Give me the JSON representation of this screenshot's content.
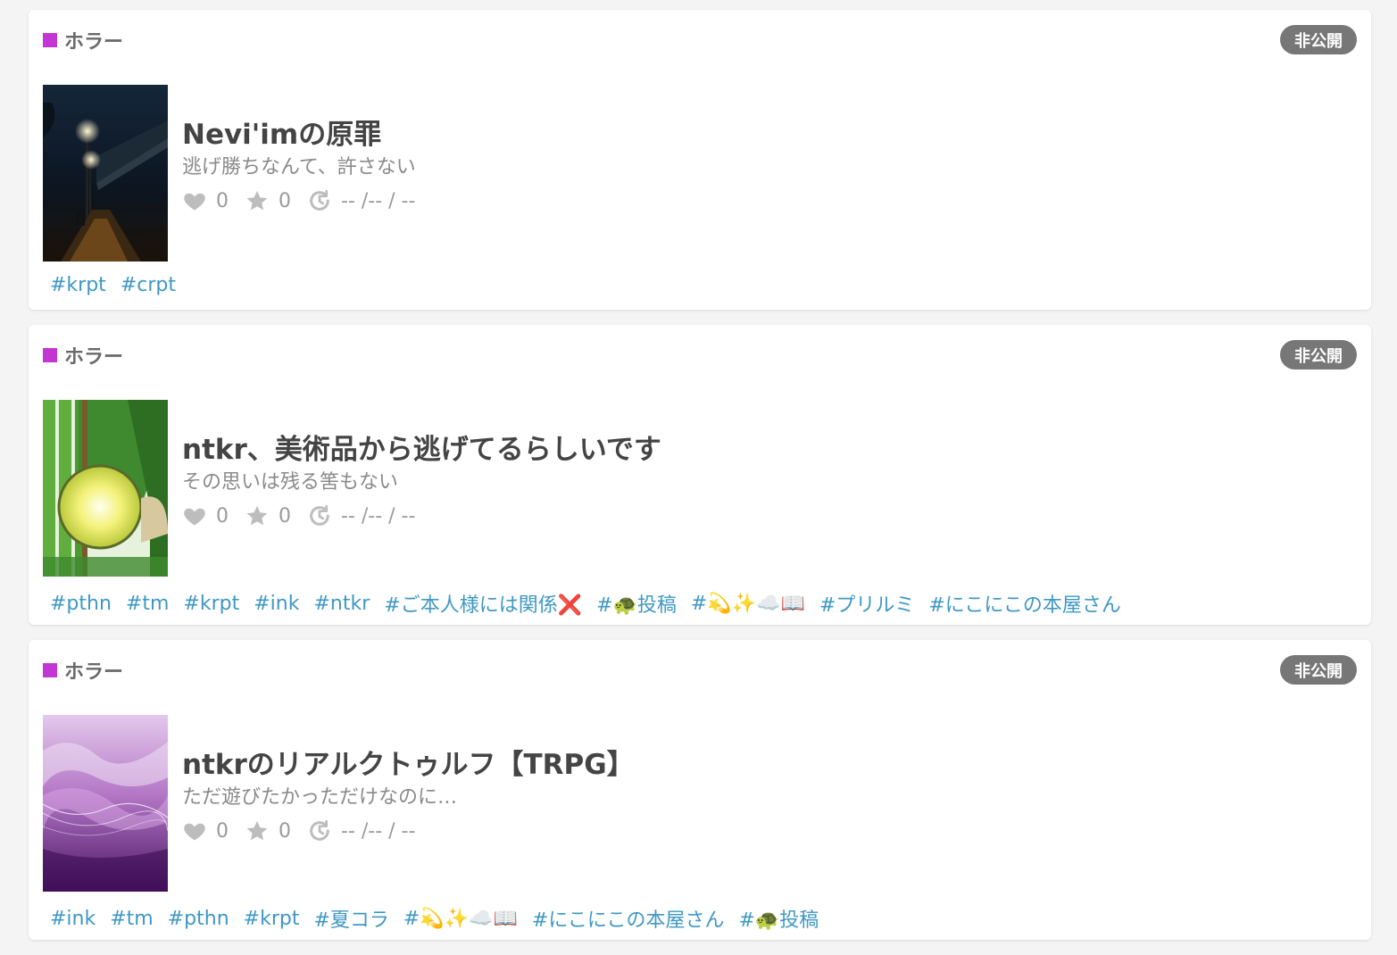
{
  "colors": {
    "genre_accent": "#c236d3",
    "tag_link": "#3f98c4",
    "badge_bg": "#777777"
  },
  "works": [
    {
      "genre": "ホラー",
      "visibility": "非公開",
      "thumbnail": "night-street-image",
      "title": "Nevi'imの原罪",
      "subtitle": "逃げ勝ちなんて、許さない",
      "likes": "0",
      "stars": "0",
      "updated": "-- /-- / --",
      "tags": [
        "#krpt",
        "#crpt"
      ]
    },
    {
      "genre": "ホラー",
      "visibility": "非公開",
      "thumbnail": "green-lantern-image",
      "title": "ntkr、美術品から逃げてるらしいです",
      "subtitle": "その思いは残る筈もない",
      "likes": "0",
      "stars": "0",
      "updated": "-- /-- / --",
      "tags": [
        "#pthn",
        "#tm",
        "#krpt",
        "#ink",
        "#ntkr",
        "#ご本人様には関係❌",
        "#🐢投稿",
        "#💫✨☁️📖",
        "#プリルミ",
        "#にこにこの本屋さん"
      ]
    },
    {
      "genre": "ホラー",
      "visibility": "非公開",
      "thumbnail": "purple-waves-image",
      "title": "ntkrのリアルクトゥルフ【TRPG】",
      "subtitle": "ただ遊びたかっただけなのに…",
      "likes": "0",
      "stars": "0",
      "updated": "-- /-- / --",
      "tags": [
        "#ink",
        "#tm",
        "#pthn",
        "#krpt",
        "#夏コラ",
        "#💫✨☁️📖",
        "#にこにこの本屋さん",
        "#🐢投稿"
      ]
    }
  ]
}
